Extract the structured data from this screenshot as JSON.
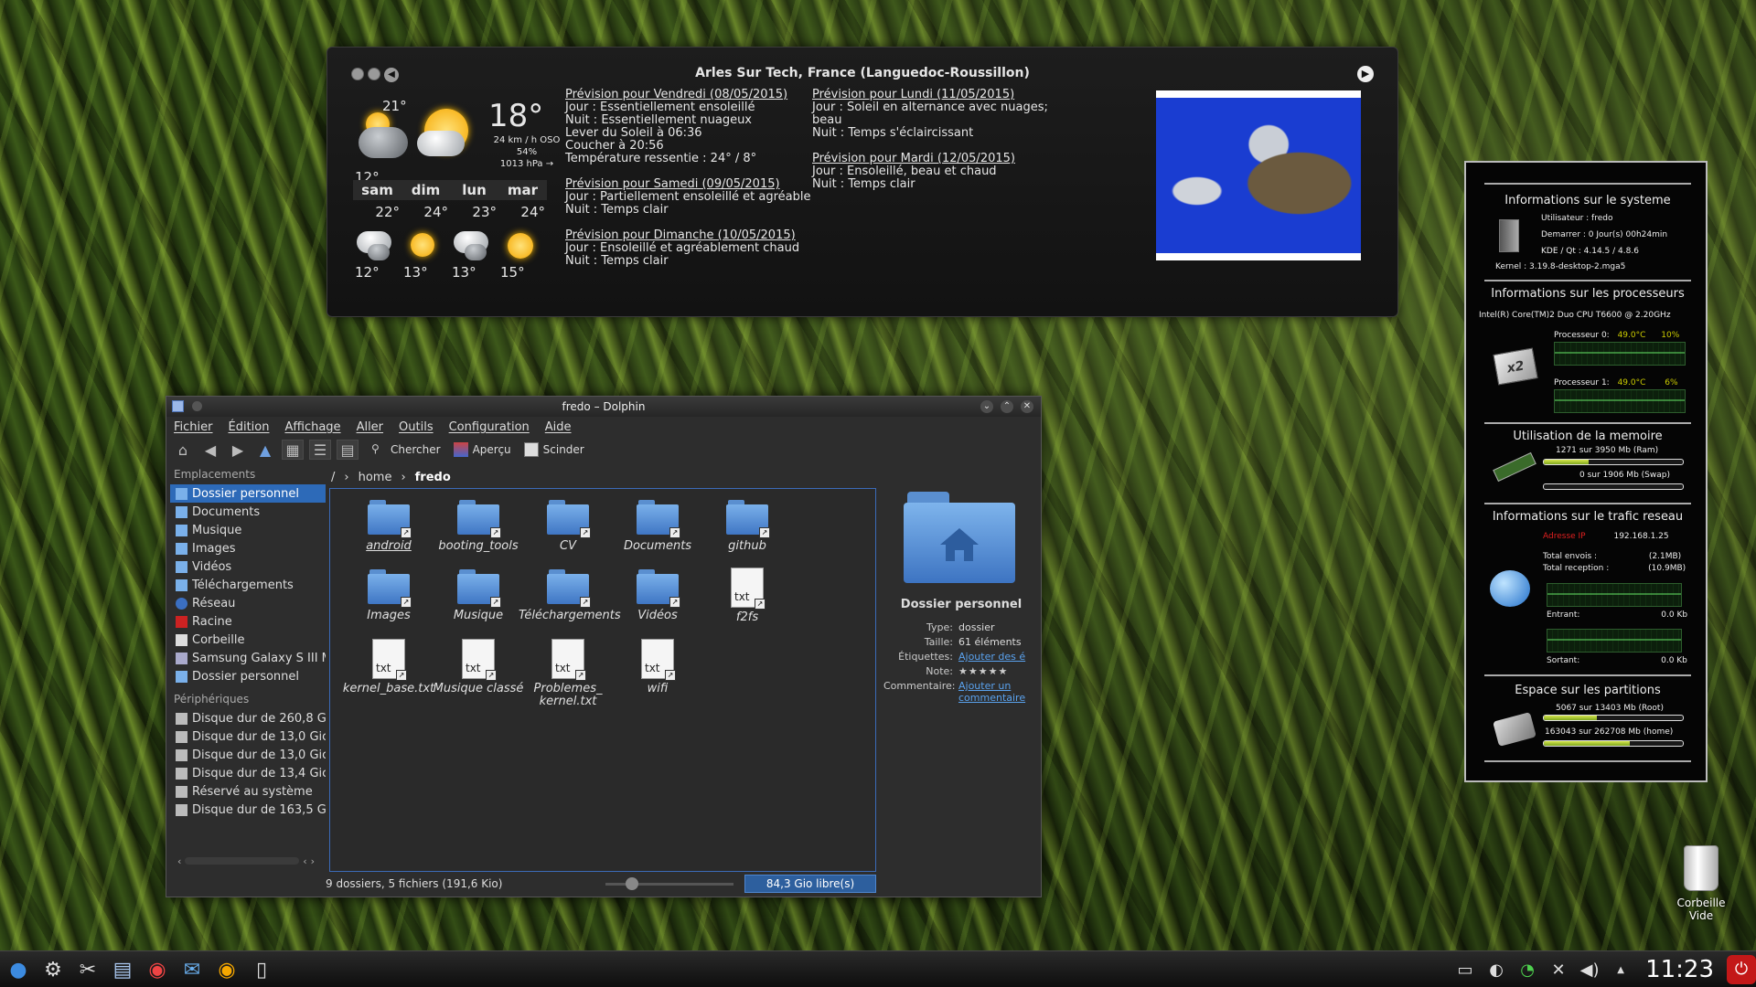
{
  "weather": {
    "location": "Arles Sur Tech, France (Languedoc-Roussillon)",
    "current": {
      "high": "21°",
      "low": "12°",
      "temp": "18°",
      "wind": "24 km / h OSO",
      "humidity": "54%",
      "pressure": "1013 hPa →"
    },
    "days": [
      {
        "name": "sam",
        "high": "22°",
        "low": "12°"
      },
      {
        "name": "dim",
        "high": "24°",
        "low": "13°"
      },
      {
        "name": "lun",
        "high": "23°",
        "low": "13°"
      },
      {
        "name": "mar",
        "high": "24°",
        "low": "15°"
      }
    ],
    "forecast_fri": {
      "title": "Prévision pour Vendredi (08/05/2015)",
      "day": "Jour : Essentiellement ensoleillé",
      "night": "Nuit : Essentiellement nuageux",
      "sunrise": "Lever du Soleil à 06:36",
      "sunset": "Coucher à 20:56",
      "feels": "Température ressentie : 24° / 8°"
    },
    "forecast_sat": {
      "title": "Prévision pour Samedi (09/05/2015)",
      "day": "Jour : Partiellement ensoleillé et agréable",
      "night": "Nuit : Temps clair"
    },
    "forecast_sun": {
      "title": "Prévision pour Dimanche (10/05/2015)",
      "day": "Jour : Ensoleillé et agréablement chaud",
      "night": "Nuit : Temps clair"
    },
    "forecast_mon": {
      "title": "Prévision pour Lundi (11/05/2015)",
      "day": "Jour : Soleil en alternance avec nuages; beau",
      "night": "Nuit : Temps s'éclaircissant"
    },
    "forecast_tue": {
      "title": "Prévision pour Mardi (12/05/2015)",
      "day": "Jour : Ensoleillé, beau et chaud",
      "night": "Nuit : Temps clair"
    }
  },
  "dolphin": {
    "title": "fredo – Dolphin",
    "menu": [
      "Fichier",
      "Édition",
      "Affichage",
      "Aller",
      "Outils",
      "Configuration",
      "Aide"
    ],
    "toolbar": {
      "search": "Chercher",
      "preview": "Aperçu",
      "split": "Scinder"
    },
    "places_header": "Emplacements",
    "places": [
      "Dossier personnel",
      "Documents",
      "Musique",
      "Images",
      "Vidéos",
      "Téléchargements",
      "Réseau",
      "Racine",
      "Corbeille",
      "Samsung Galaxy S III M",
      "Dossier personnel"
    ],
    "devices_header": "Périphériques",
    "devices": [
      "Disque dur de 260,8 G",
      "Disque dur de 13,0 Gic",
      "Disque dur de 13,0 Gic",
      "Disque dur de 13,4 Gic",
      "Réservé au système",
      "Disque dur de 163,5 G"
    ],
    "breadcrumb": {
      "root": "/",
      "home": "home",
      "current": "fredo"
    },
    "files": [
      {
        "name": "android",
        "kind": "folder"
      },
      {
        "name": "booting_tools",
        "kind": "folder"
      },
      {
        "name": "CV",
        "kind": "folder"
      },
      {
        "name": "Documents",
        "kind": "folder"
      },
      {
        "name": "github",
        "kind": "folder"
      },
      {
        "name": "Images",
        "kind": "folder"
      },
      {
        "name": "Musique",
        "kind": "folder"
      },
      {
        "name": "Téléchargements",
        "kind": "folder"
      },
      {
        "name": "Vidéos",
        "kind": "folder"
      },
      {
        "name": "f2fs",
        "kind": "txt"
      },
      {
        "name": "kernel_base.txt",
        "kind": "txt"
      },
      {
        "name": "Musique classé",
        "kind": "txt"
      },
      {
        "name": "Problemes_ kernel.txt",
        "kind": "txt"
      },
      {
        "name": "wifi",
        "kind": "txt"
      }
    ],
    "txt_icon_label": "txt",
    "info": {
      "title": "Dossier personnel",
      "type_k": "Type:",
      "type_v": "dossier",
      "size_k": "Taille:",
      "size_v": "61 éléments",
      "tags_k": "Étiquettes:",
      "tags_v": "Ajouter des é",
      "rating_k": "Note:",
      "rating_v": "★★★★★",
      "comment_k": "Commentaire:",
      "comment_v1": "Ajouter un",
      "comment_v2": "commentaire"
    },
    "status": "9 dossiers, 5 fichiers (191,6 Kio)",
    "free": "84,3 Gio libre(s)"
  },
  "sysmon": {
    "sys_title": "Informations sur le systeme",
    "user": "Utilisateur : fredo",
    "uptime": "Demarrer :   0 Jour(s) 00h24min",
    "kde": "KDE / Qt :   4.14.5 / 4.8.6",
    "kernel": "Kernel :    3.19.8-desktop-2.mga5",
    "cpu_title": "Informations sur les processeurs",
    "cpu_model": "Intel(R) Core(TM)2 Duo CPU     T6600  @ 2.20GHz",
    "cpu0_label": "Processeur 0:",
    "cpu0_temp": "49.0°C",
    "cpu0_load": "10%",
    "cpu1_label": "Processeur 1:",
    "cpu1_temp": "49.0°C",
    "cpu1_load": "6%",
    "cpu_chip_label": "x2",
    "mem_title": "Utilisation de la memoire",
    "ram": "1271   sur  3950 Mb  (Ram)",
    "swap": "0   sur  1906 Mb  (Swap)",
    "ram_fraction": 0.32,
    "swap_fraction": 0.0,
    "net_title": "Informations sur le trafic reseau",
    "ip_label": "Adresse IP",
    "ip": "192.168.1.25",
    "sent_label": "Total envois :",
    "sent": "(2.1MB)",
    "recv_label": "Total reception :",
    "recv": "(10.9MB)",
    "in_label": "Entrant:",
    "in": "0.0 Kb",
    "out_label": "Sortant:",
    "out": "0.0 Kb",
    "disk_title": "Espace sur les partitions",
    "root": "5067   sur  13403 Mb  (Root)",
    "home": "163043   sur  262708 Mb  (home)",
    "root_fraction": 0.38,
    "home_fraction": 0.62,
    "accent": "#cccc00"
  },
  "desktop": {
    "trash_label1": "Corbeille",
    "trash_label2": "Vide"
  },
  "taskbar": {
    "clock": "11:23"
  }
}
